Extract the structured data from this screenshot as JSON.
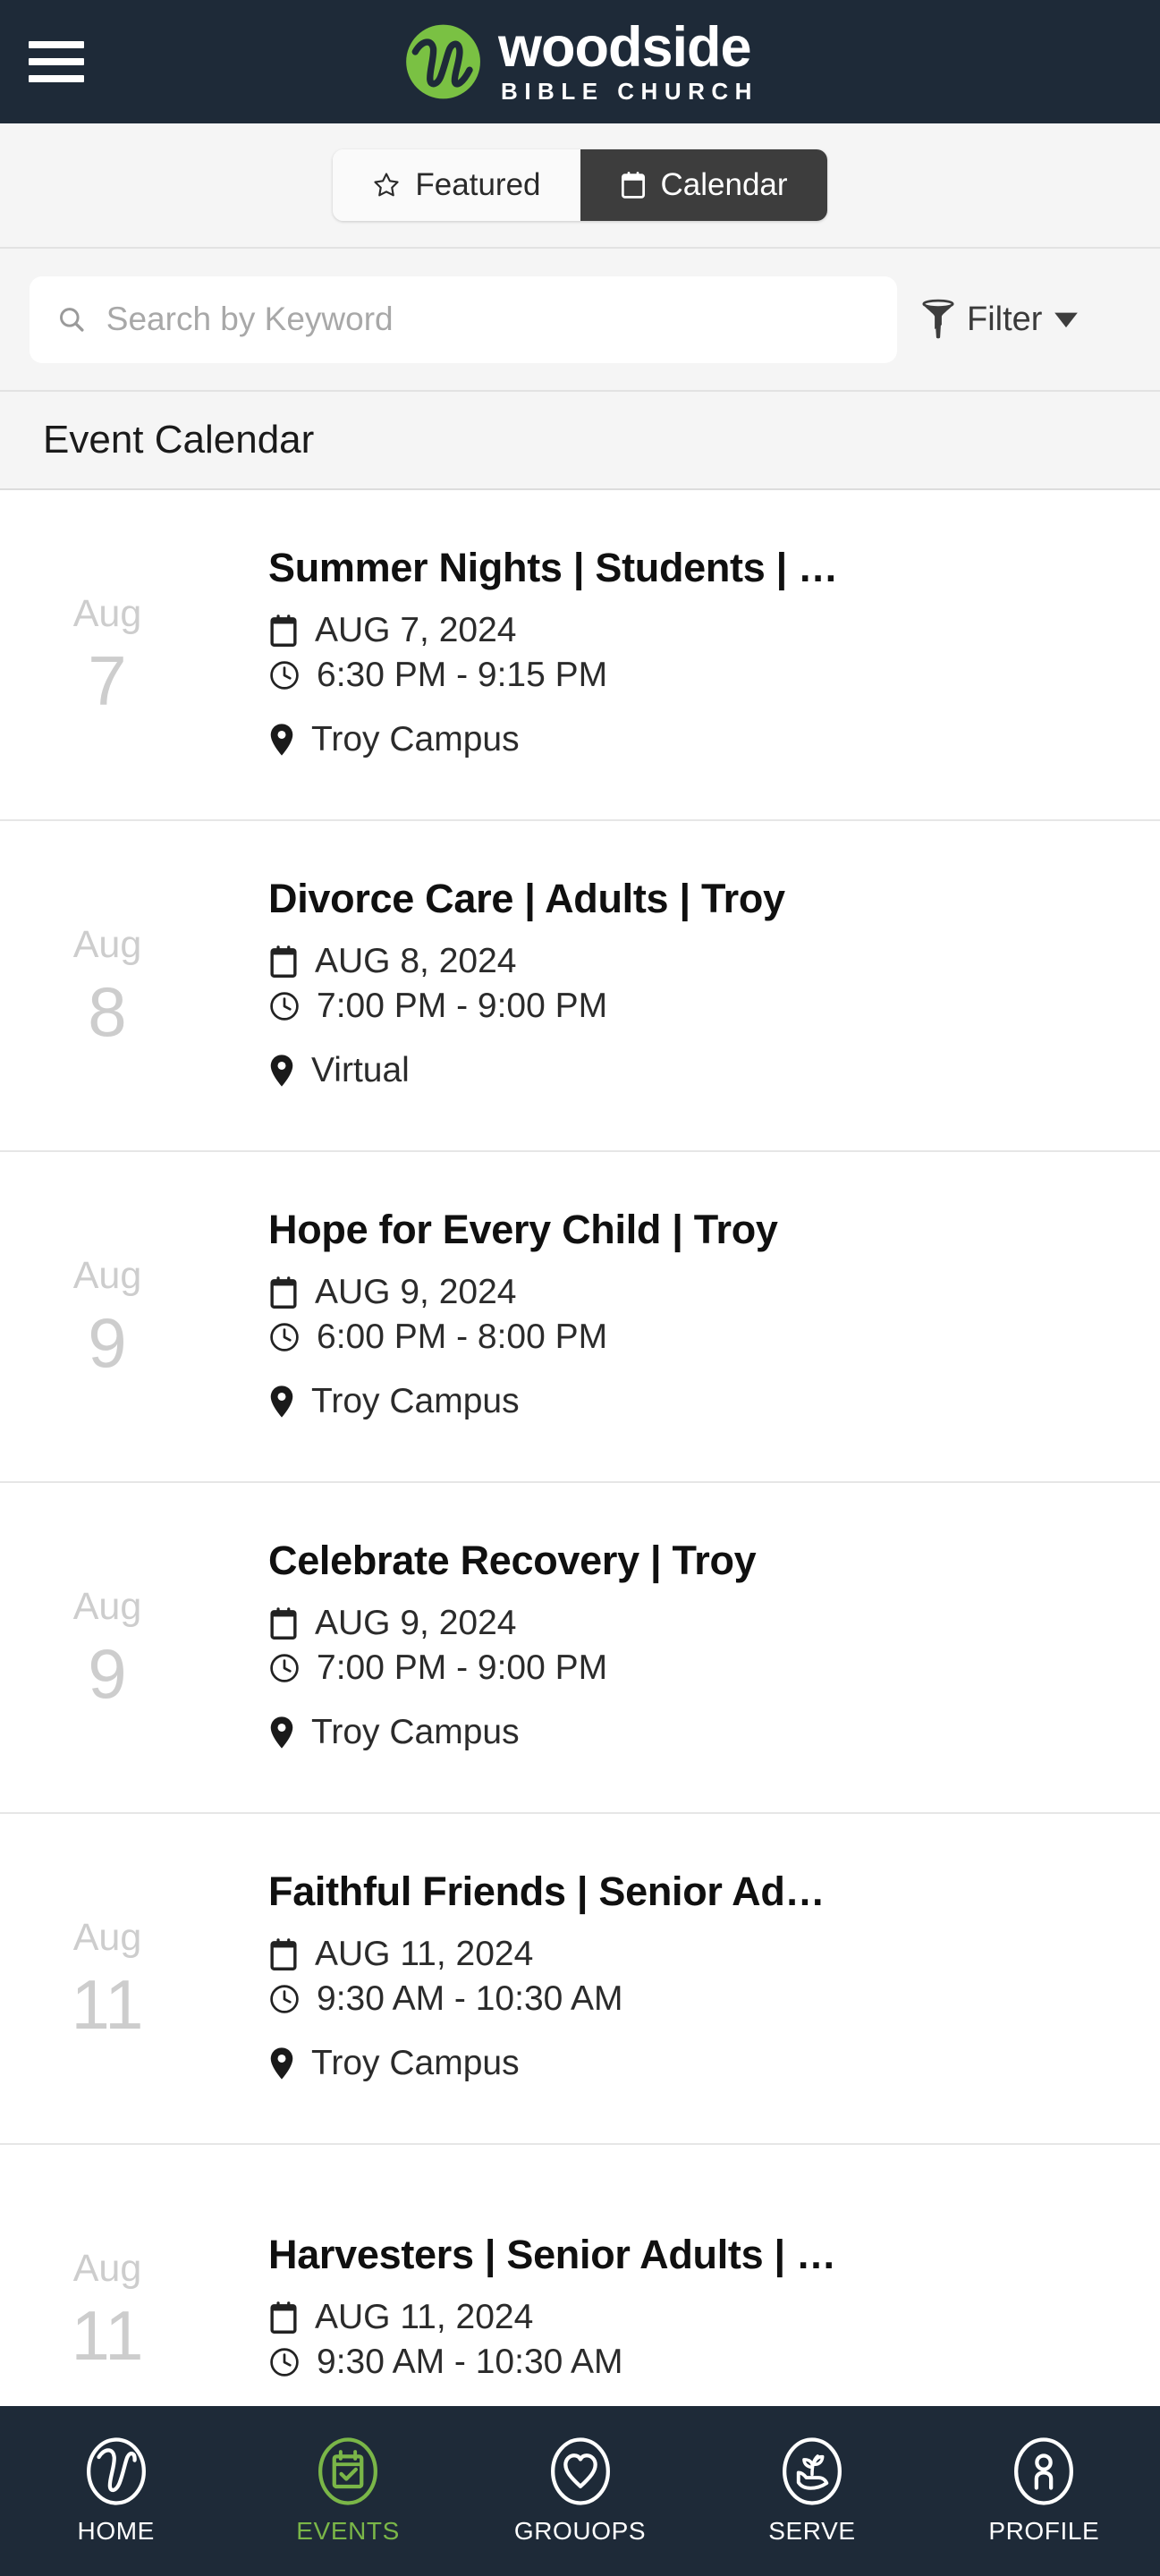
{
  "header": {
    "menu_icon": "hamburger-menu-icon",
    "brand_name": "woodside",
    "brand_sub": "BIBLE CHURCH",
    "logo_icon": "woodside-w-logo-icon",
    "bg_color": "#1e2a38",
    "accent_green": "#7ab648"
  },
  "tabs": {
    "featured": {
      "label": "Featured",
      "icon": "star-icon",
      "active": false
    },
    "calendar": {
      "label": "Calendar",
      "icon": "calendar-icon",
      "active": true
    }
  },
  "search": {
    "placeholder": "Search by Keyword",
    "value": "",
    "icon": "search-icon"
  },
  "filter": {
    "label": "Filter",
    "icon": "funnel-icon",
    "caret": "chevron-down-icon"
  },
  "section": {
    "title": "Event Calendar"
  },
  "events": [
    {
      "month": "Aug",
      "day": "7",
      "title": "Summer Nights | Students | …",
      "date": "AUG 7, 2024",
      "time": "6:30 PM - 9:15 PM",
      "location": "Troy Campus"
    },
    {
      "month": "Aug",
      "day": "8",
      "title": "Divorce Care | Adults | Troy",
      "date": "AUG 8, 2024",
      "time": "7:00 PM - 9:00 PM",
      "location": "Virtual"
    },
    {
      "month": "Aug",
      "day": "9",
      "title": "Hope for Every Child | Troy",
      "date": "AUG 9, 2024",
      "time": "6:00 PM - 8:00 PM",
      "location": "Troy Campus"
    },
    {
      "month": "Aug",
      "day": "9",
      "title": "Celebrate Recovery | Troy",
      "date": "AUG 9, 2024",
      "time": "7:00 PM - 9:00 PM",
      "location": "Troy Campus"
    },
    {
      "month": "Aug",
      "day": "11",
      "title": "Faithful Friends | Senior Ad…",
      "date": "AUG 11, 2024",
      "time": "9:30 AM - 10:30 AM",
      "location": "Troy Campus"
    },
    {
      "month": "Aug",
      "day": "11",
      "title": "Harvesters | Senior Adults | …",
      "date": "AUG 11, 2024",
      "time": "9:30 AM - 10:30 AM",
      "location": ""
    }
  ],
  "bottom_nav": [
    {
      "label": "HOME",
      "icon": "woodside-w-circle-icon",
      "active": false
    },
    {
      "label": "EVENTS",
      "icon": "calendar-check-circle-icon",
      "active": true
    },
    {
      "label": "GROUOPS",
      "icon": "heart-circle-icon",
      "active": false
    },
    {
      "label": "SERVE",
      "icon": "hand-plant-circle-icon",
      "active": false
    },
    {
      "label": "PROFILE",
      "icon": "person-circle-icon",
      "active": false
    }
  ]
}
